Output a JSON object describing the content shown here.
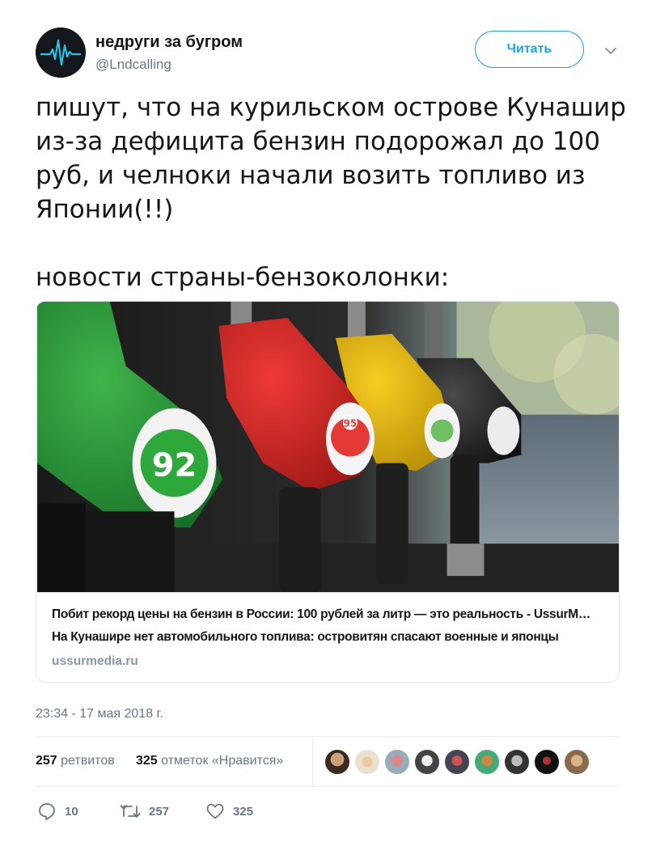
{
  "user": {
    "name": "недруги за бугром",
    "handle": "@Lndcalling"
  },
  "follow_button": "Читать",
  "tweet": {
    "text": "пишут, что на курильском острове Кунашир\nиз-за дефицита бензин подорожал до 100\nруб, и челноки начали возить топливо из\nЯпонии(!!)\n\nновости страны-бензоколонки:"
  },
  "card": {
    "title": "Побит рекорд цены на бензин в России: 100 рублей за литр — это реальность - UssurM…",
    "description": "На Кунашире нет автомобильного топлива: островитян спасают военные и японцы",
    "domain": "ussurmedia.ru",
    "image": {
      "nozzle_labels": [
        "92",
        "95"
      ]
    }
  },
  "timestamp": "23:34 - 17 мая 2018 г.",
  "stats": {
    "retweets_count": "257",
    "retweets_label": "ретвитов",
    "likes_count": "325",
    "likes_label": "отметок «Нравится»"
  },
  "actions": {
    "replies": "10",
    "retweets": "257",
    "likes": "325"
  },
  "colors": {
    "accent": "#1da1f2",
    "text_primary": "#14171a",
    "text_secondary": "#657786",
    "border": "#e1e8ed"
  }
}
